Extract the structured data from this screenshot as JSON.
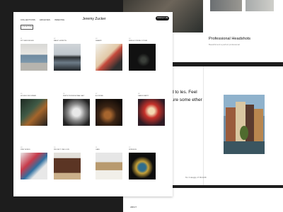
{
  "main": {
    "nav": [
      "COLLECTIONS",
      "ARCHIVES",
      "INDEXING"
    ],
    "brand": "Jeremy Zucker",
    "contact": "CONTACT ME",
    "collection_button": "COLLECTION",
    "grid": [
      {
        "num": "01",
        "title": "KITCHEN DESIGN"
      },
      {
        "num": "02",
        "title": "MAGIC HORIZON"
      },
      {
        "num": "03",
        "title": "SHABBY"
      },
      {
        "num": "04",
        "title": "FRESH COFFEE CUTLER"
      },
      {
        "num": "05",
        "title": "HOUSE FOR DINNER"
      },
      {
        "num": "06",
        "title": "WHITE PROFESSIONAL SALT"
      },
      {
        "num": "07",
        "title": "A COFFEE"
      },
      {
        "num": "08",
        "title": "DANCE PARTY"
      },
      {
        "num": "09",
        "title": "PINK WORLD"
      },
      {
        "num": "10",
        "title": "PROJECT ONE LOVE"
      },
      {
        "num": "11",
        "title": "CAFE"
      },
      {
        "num": "12",
        "title": "SPENDIVE"
      }
    ]
  },
  "back": {
    "photo_title": "Professional Headshots",
    "photo_sub": "Beautiful and a perfect professional",
    "big_text": "ected to les. Feel free ure some ether",
    "big_text_tail": "m",
    "footer_note": "Tel. 3 Hengky 17 99 2218",
    "about": "ABOUT"
  }
}
